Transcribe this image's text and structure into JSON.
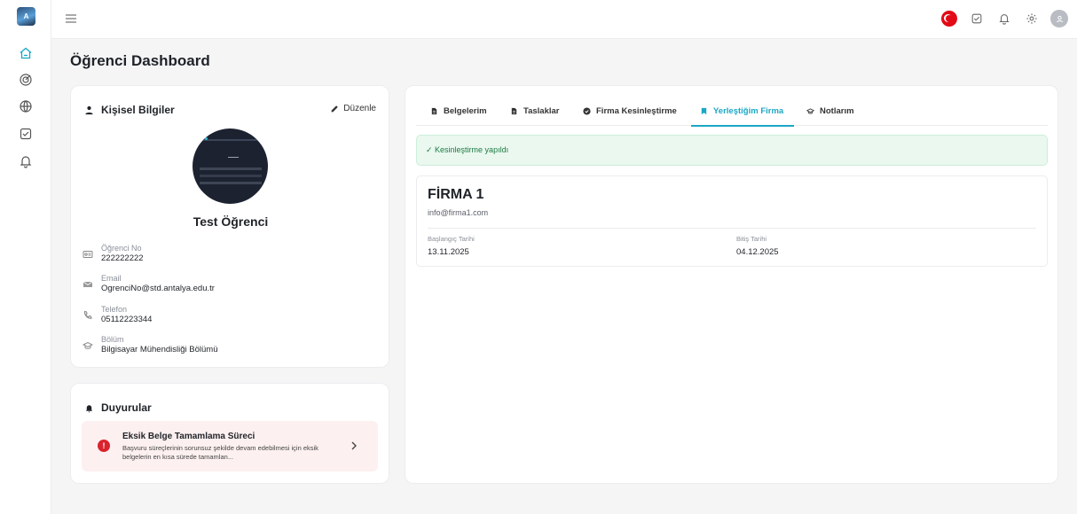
{
  "app": {
    "logo_text": "A"
  },
  "page": {
    "title": "Öğrenci Dashboard"
  },
  "personal": {
    "title": "Kişisel Bilgiler",
    "edit_label": "Düzenle",
    "name": "Test Öğrenci",
    "fields": [
      {
        "label": "Öğrenci No",
        "value": "222222222",
        "icon": "id-card-icon"
      },
      {
        "label": "Email",
        "value": "OgrenciNo@std.antalya.edu.tr",
        "icon": "mail-icon"
      },
      {
        "label": "Telefon",
        "value": "05112223344",
        "icon": "phone-icon"
      },
      {
        "label": "Bölüm",
        "value": "Bilgisayar Mühendisliği Bölümü",
        "icon": "graduation-cap-icon"
      }
    ]
  },
  "announcements": {
    "title": "Duyurular",
    "items": [
      {
        "title": "Eksik Belge Tamamlama Süreci",
        "description": "Başvuru süreçlerinin sorunsuz şekilde devam edebilmesi için eksik belgelerin en kısa sürede tamamlan...",
        "icon": "alert-icon"
      }
    ]
  },
  "tabs": [
    {
      "label": "Belgelerim",
      "icon": "document-icon",
      "active": false
    },
    {
      "label": "Taslaklar",
      "icon": "draft-icon",
      "active": false
    },
    {
      "label": "Firma Kesinleştirme",
      "icon": "check-circle-icon",
      "active": false
    },
    {
      "label": "Yerleştiğim Firma",
      "icon": "bookmark-icon",
      "active": true
    },
    {
      "label": "Notlarım",
      "icon": "graduation-cap-icon",
      "active": false
    }
  ],
  "status": {
    "message": "✓ Kesinleştirme yapıldı"
  },
  "firm": {
    "name": "FİRMA 1",
    "email": "info@firma1.com",
    "start_label": "Başlangıç Tarihi",
    "start_value": "13.11.2025",
    "end_label": "Bitiş Tarihi",
    "end_value": "04.12.2025"
  },
  "colors": {
    "accent": "#1aa7c4",
    "success_bg": "#eaf8ef",
    "alert": "#d9232e",
    "announce_bg": "#fdf0f0"
  }
}
